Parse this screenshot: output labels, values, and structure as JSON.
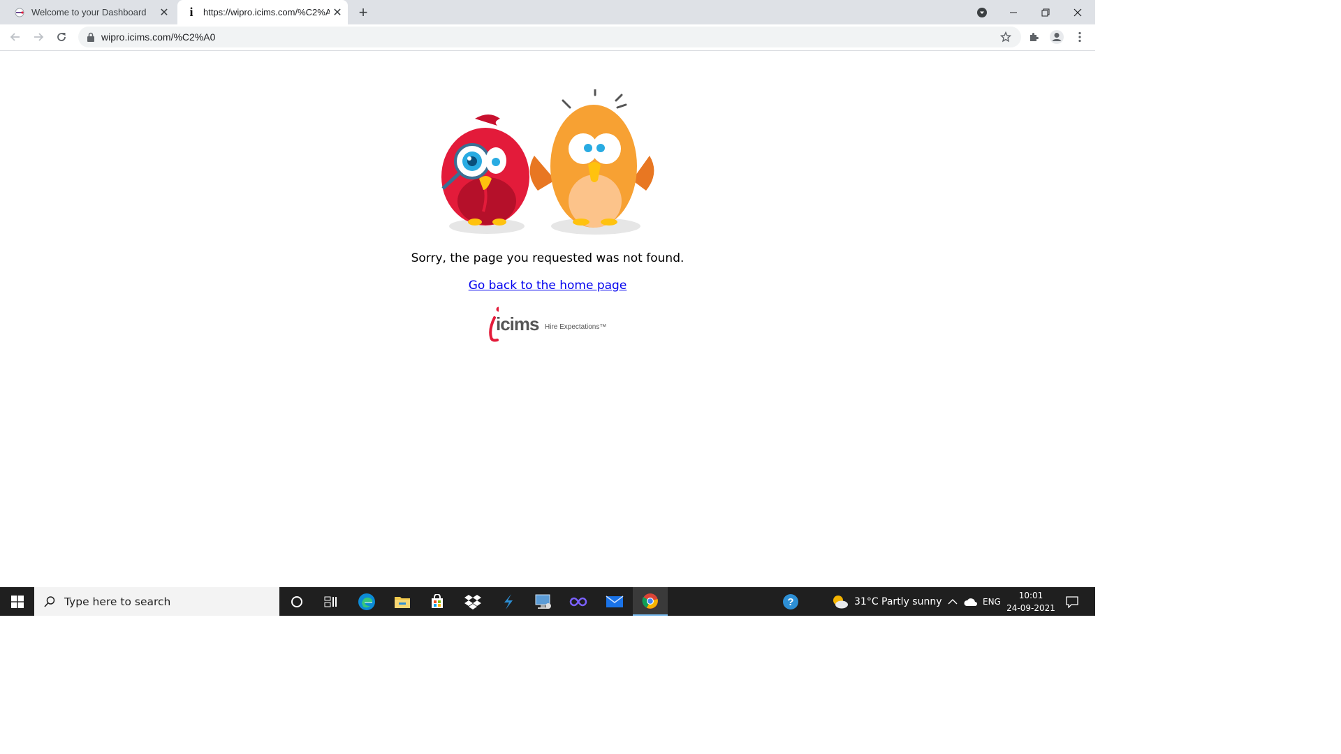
{
  "browser": {
    "tabs": [
      {
        "title": "Welcome to your Dashboard",
        "active": false
      },
      {
        "title": "https://wipro.icims.com/%C2%A0",
        "active": true
      }
    ],
    "url": "wipro.icims.com/%C2%A0"
  },
  "page": {
    "error_message": "Sorry, the page you requested was not found.",
    "home_link": "Go back to the home page",
    "logo_text": "icims",
    "logo_tagline": "Hire Expectations™"
  },
  "taskbar": {
    "search_placeholder": "Type here to search",
    "weather": "31°C  Partly sunny",
    "language": "ENG",
    "time": "10:01",
    "date": "24-09-2021"
  },
  "colors": {
    "link": "#0000ee",
    "red_bird": "#e31b3a",
    "orange_bird": "#f7a133",
    "taskbar": "#1f1f1f"
  }
}
